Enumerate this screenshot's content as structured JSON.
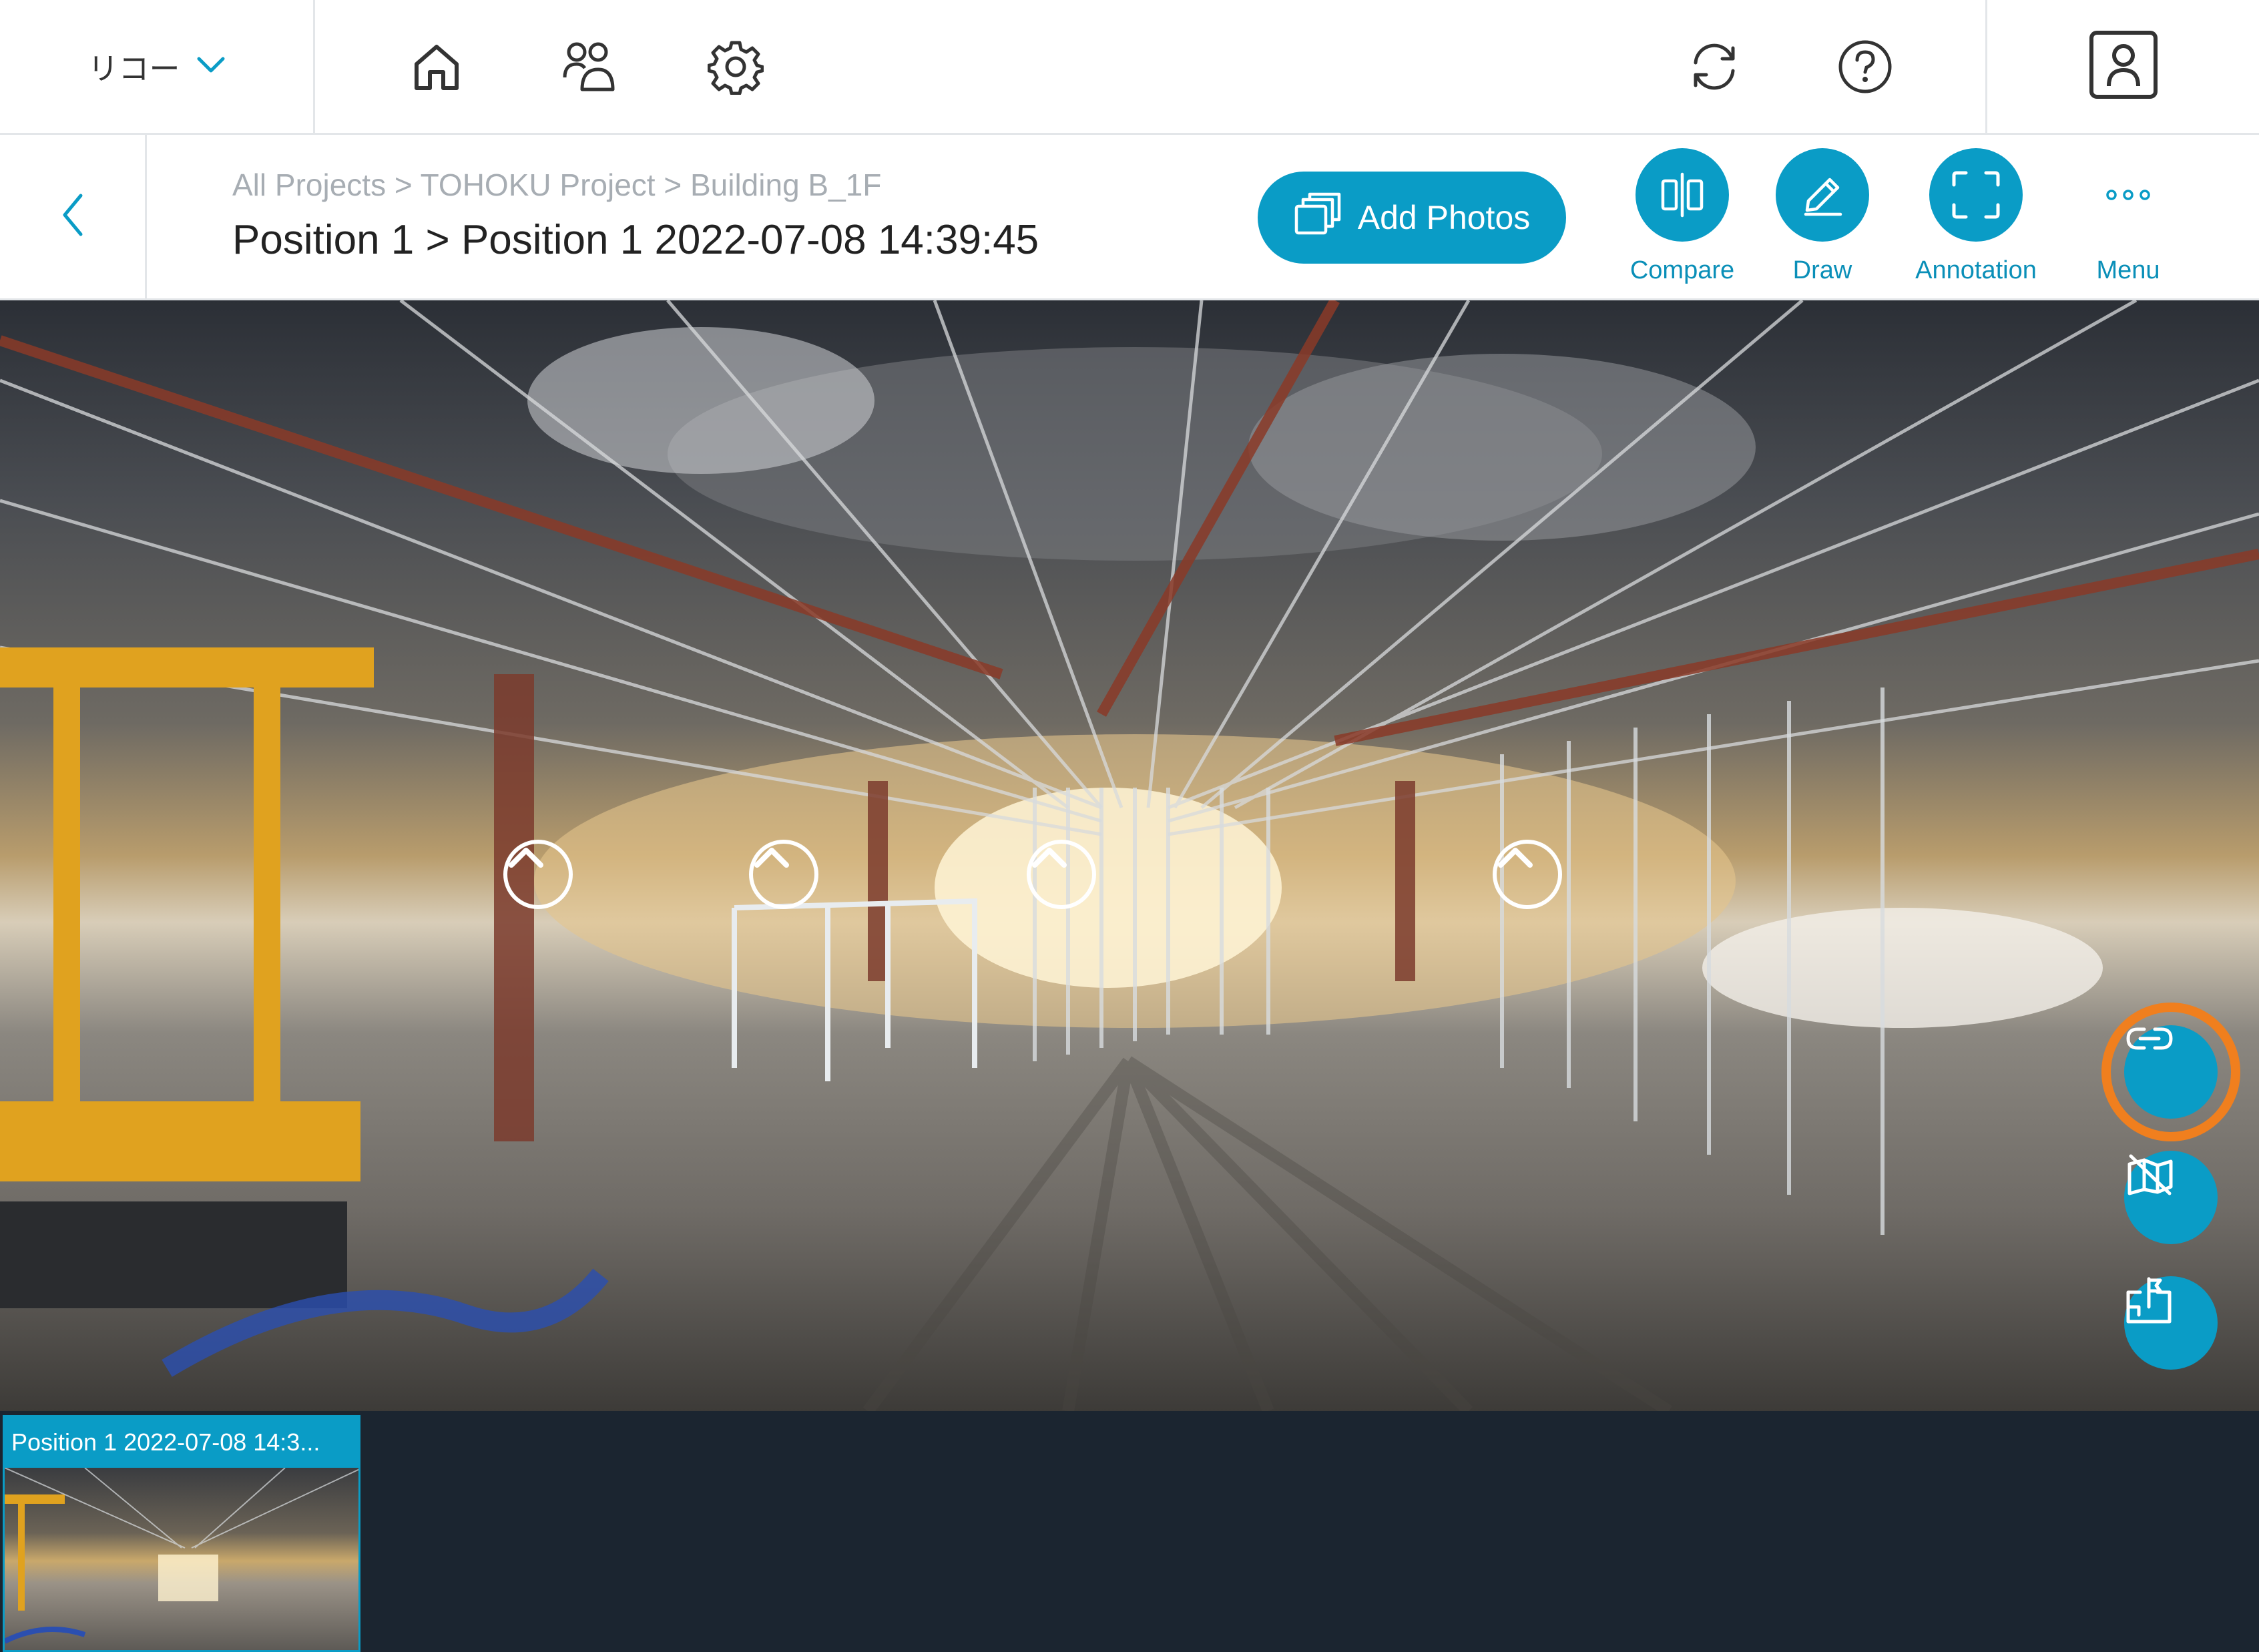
{
  "topbar": {
    "org_name": "リコー",
    "icons": [
      "chevron-down-icon",
      "home-icon",
      "users-icon",
      "gear-icon",
      "refresh-icon",
      "help-icon",
      "profile-icon"
    ]
  },
  "header": {
    "breadcrumb": "All Projects > TOHOKU Project > Building B_1F",
    "title": "Position 1 > Position 1 2022-07-08 14:39:45",
    "add_photos_label": "Add Photos",
    "tools": {
      "compare": "Compare",
      "draw": "Draw",
      "annotation": "Annotation",
      "menu": "Menu"
    }
  },
  "viewer": {
    "hotspot_count": 4,
    "overlay_buttons": [
      "link-icon",
      "hide-markers-icon",
      "floorplan-pin-icon"
    ],
    "highlighted_button": "link-icon",
    "highlight_color": "#f07f1e"
  },
  "thumbnails": [
    {
      "label": "Position 1 2022-07-08 14:3..."
    }
  ],
  "colors": {
    "accent": "#0a9cc6",
    "strip_background": "#1b2530"
  }
}
